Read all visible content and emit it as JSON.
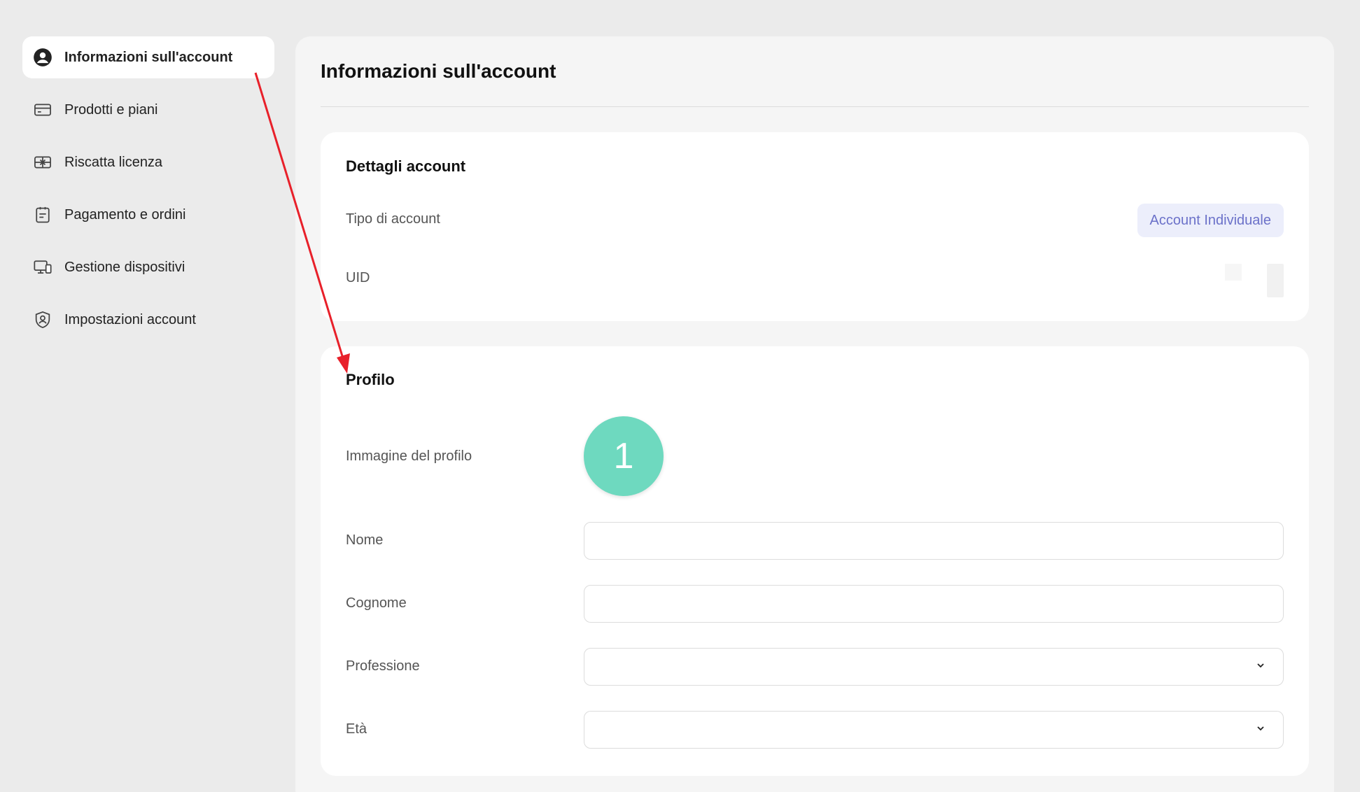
{
  "sidebar": {
    "items": [
      {
        "label": "Informazioni sull'account",
        "icon": "user-circle-icon",
        "active": true
      },
      {
        "label": "Prodotti e piani",
        "icon": "credit-card-icon",
        "active": false
      },
      {
        "label": "Riscatta licenza",
        "icon": "gift-icon",
        "active": false
      },
      {
        "label": "Pagamento e ordini",
        "icon": "clipboard-icon",
        "active": false
      },
      {
        "label": "Gestione dispositivi",
        "icon": "devices-icon",
        "active": false
      },
      {
        "label": "Impostazioni account",
        "icon": "shield-user-icon",
        "active": false
      }
    ]
  },
  "main": {
    "title": "Informazioni sull'account",
    "details": {
      "title": "Dettagli account",
      "account_type_label": "Tipo di account",
      "account_type_value": "Account Individuale",
      "uid_label": "UID"
    },
    "profile": {
      "title": "Profilo",
      "image_label": "Immagine del profilo",
      "avatar_text": "1",
      "first_name_label": "Nome",
      "first_name_value": "",
      "last_name_label": "Cognome",
      "last_name_value": "",
      "profession_label": "Professione",
      "profession_value": "",
      "age_label": "Età",
      "age_value": ""
    }
  },
  "colors": {
    "page_bg": "#ebebeb",
    "panel_bg": "#f5f5f5",
    "badge_bg": "#eceefb",
    "badge_text": "#6b71c9",
    "avatar_bg": "#6ed9bf",
    "annotation_arrow": "#e8202a"
  }
}
